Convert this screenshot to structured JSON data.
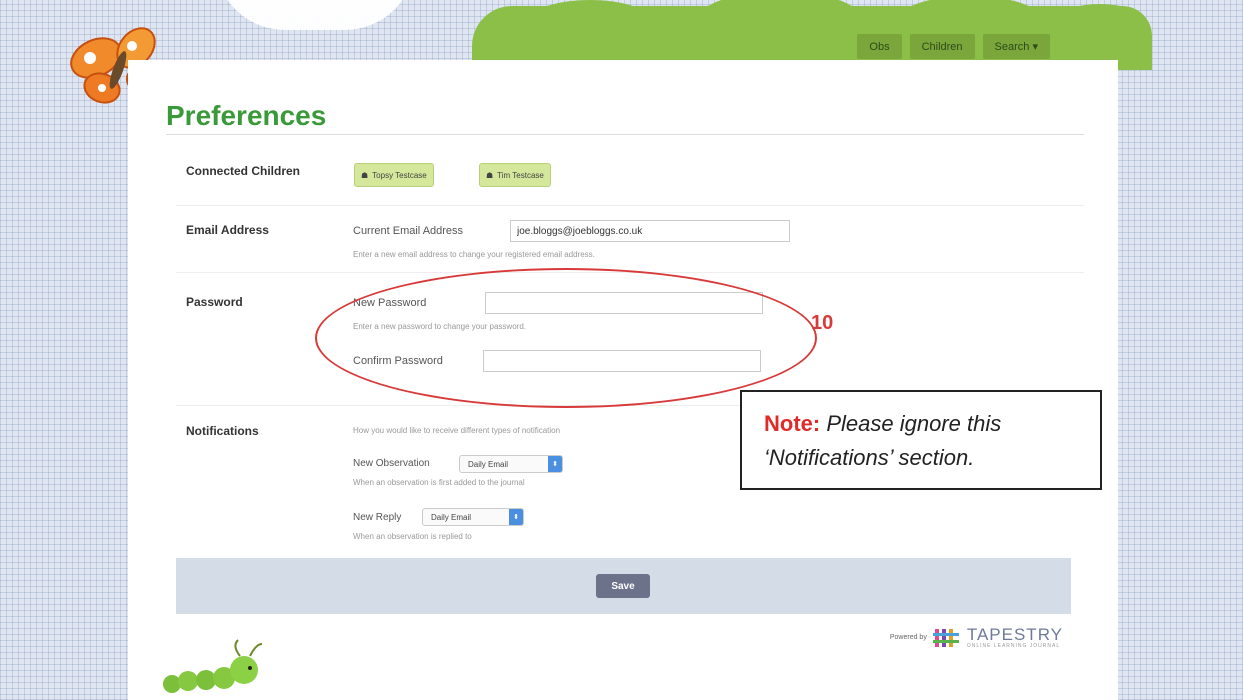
{
  "nav": {
    "items": [
      "Obs",
      "Children",
      "Search"
    ]
  },
  "page": {
    "title": "Preferences"
  },
  "connected": {
    "label": "Connected Children",
    "children": [
      "Topsy Testcase",
      "Tim Testcase"
    ]
  },
  "email": {
    "label": "Email Address",
    "current_label": "Current Email Address",
    "value": "joe.bloggs@joebloggs.co.uk",
    "help": "Enter a new email address to change your registered email address."
  },
  "password": {
    "label": "Password",
    "new_label": "New Password",
    "new_help": "Enter a new password to change your password.",
    "confirm_label": "Confirm Password"
  },
  "notifications": {
    "label": "Notifications",
    "intro": "How you would like to receive different types of notification",
    "observation": {
      "label": "New Observation",
      "selected": "Daily Email",
      "help": "When an observation is first added to the journal"
    },
    "reply": {
      "label": "New Reply",
      "selected": "Daily Email",
      "help": "When an observation is replied to"
    }
  },
  "save_label": "Save",
  "footer": {
    "powered_by": "Powered by",
    "brand": "TAPESTRY",
    "tagline": "ONLINE LEARNING JOURNAL"
  },
  "annotation": {
    "number": "10",
    "note_bold": "Note:",
    "note_text": "Please ignore this ‘Notifications’ section."
  },
  "colors": {
    "title_green": "#3a9a3a",
    "annotation_red": "#d83a3a",
    "chip_green": "#d4e79a"
  }
}
